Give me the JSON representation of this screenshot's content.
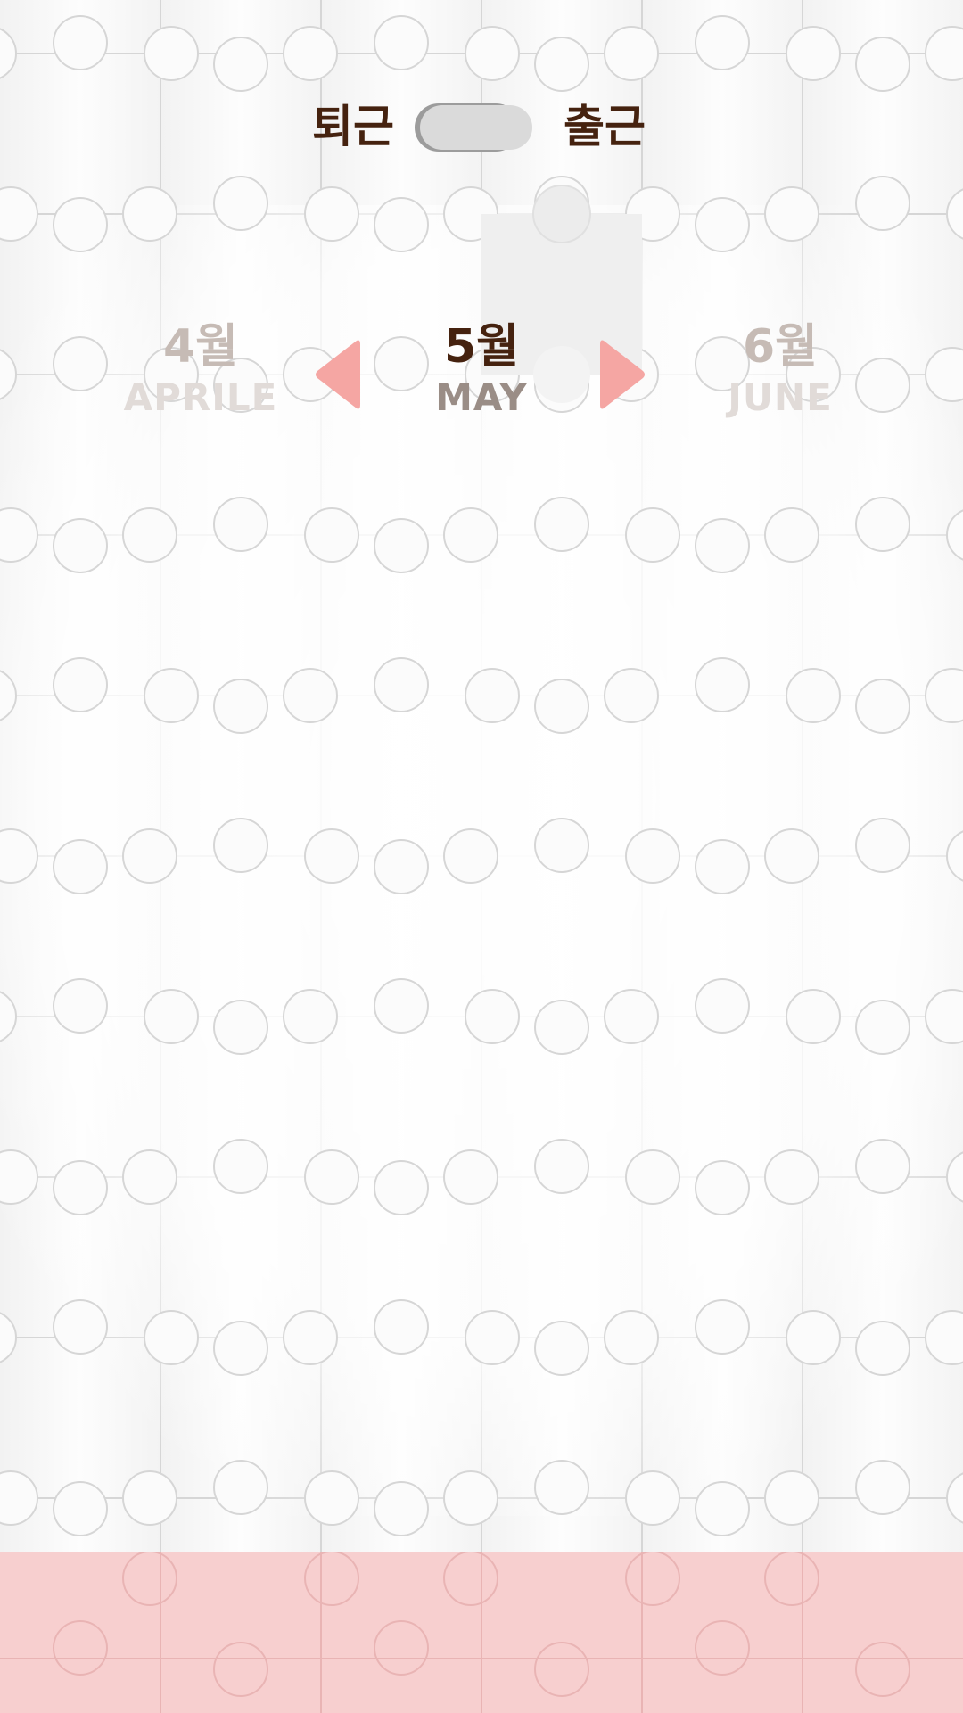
{
  "colors": {
    "brand_dark": "#45220f",
    "arrow": "#f5a6a3",
    "bottom_band": "#f7cfcf",
    "toggle_track": "#dadada"
  },
  "header": {
    "toggle_off_label": "퇴근",
    "toggle_on_label": "출근",
    "toggle_state": "off"
  },
  "months": {
    "prev": {
      "kr": "4월",
      "en": "APRILE"
    },
    "current": {
      "kr": "5월",
      "en": "MAY"
    },
    "next": {
      "kr": "6월",
      "en": "JUNE"
    }
  },
  "icons": {
    "prev": "triangle-left-icon",
    "next": "triangle-right-icon"
  }
}
